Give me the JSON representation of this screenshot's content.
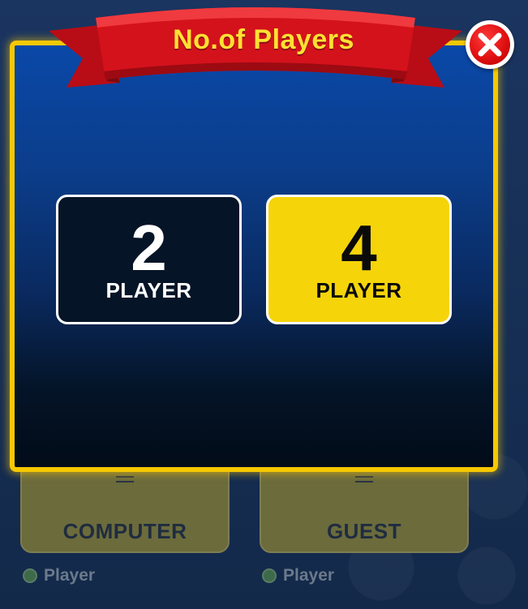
{
  "dialog": {
    "title": "No.of Players",
    "close_icon": "close-icon"
  },
  "options": [
    {
      "number": "2",
      "label": "PLAYER"
    },
    {
      "number": "4",
      "label": "PLAYER"
    }
  ],
  "background": {
    "cards": [
      {
        "label": "COMPUTER"
      },
      {
        "label": "GUEST"
      }
    ],
    "radios": [
      {
        "label": "Player"
      },
      {
        "label": "Player"
      }
    ]
  },
  "colors": {
    "accent_yellow": "#f5c800",
    "ribbon_red": "#c8101a",
    "title_yellow": "#ffe133",
    "close_red": "#e01010"
  }
}
